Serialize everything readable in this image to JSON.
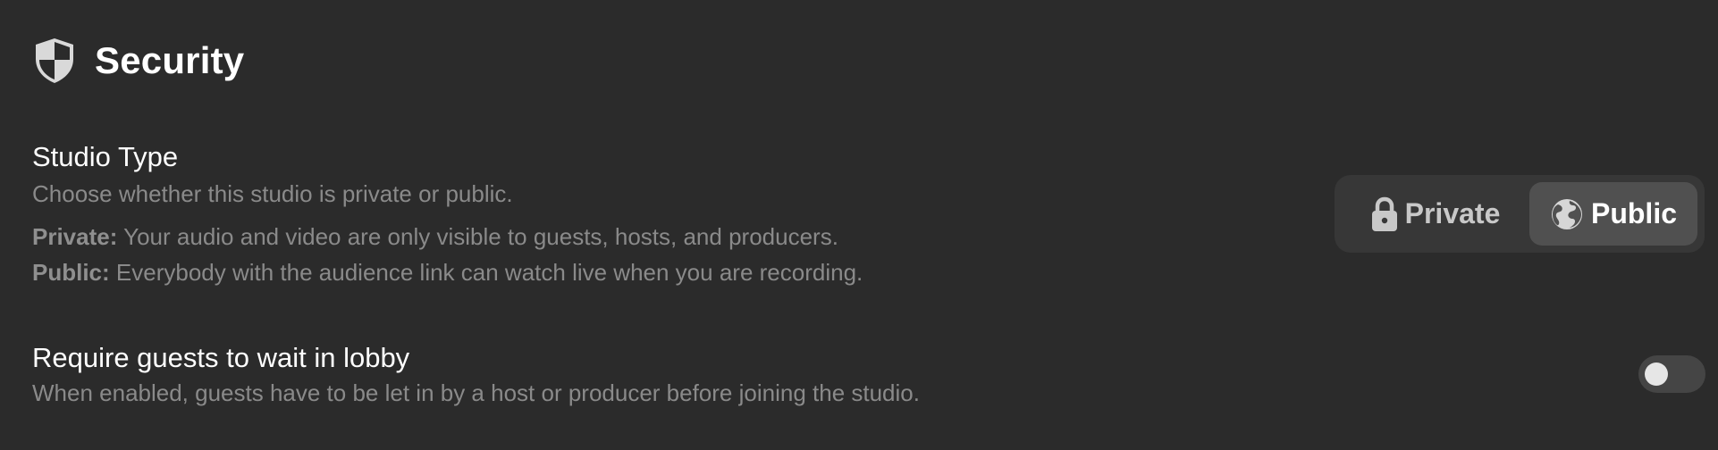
{
  "section": {
    "title": "Security",
    "icon": "shield-icon"
  },
  "studio_type": {
    "title": "Studio Type",
    "description": "Choose whether this studio is private or public.",
    "private_label": "Private:",
    "private_text": " Your audio and video are only visible to guests, hosts, and producers.",
    "public_label": "Public:",
    "public_text": " Everybody with the audience link can watch live when you are recording.",
    "options": [
      {
        "label": "Private",
        "icon": "lock-icon",
        "selected": false
      },
      {
        "label": "Public",
        "icon": "globe-icon",
        "selected": true
      }
    ]
  },
  "lobby": {
    "title": "Require guests to wait in lobby",
    "description": "When enabled, guests have to be let in by a host or producer before joining the studio.",
    "enabled": false
  },
  "colors": {
    "background": "#2b2b2b",
    "control_bg": "#373737",
    "selected_bg": "#505050",
    "muted_text": "#8a8a8a"
  }
}
